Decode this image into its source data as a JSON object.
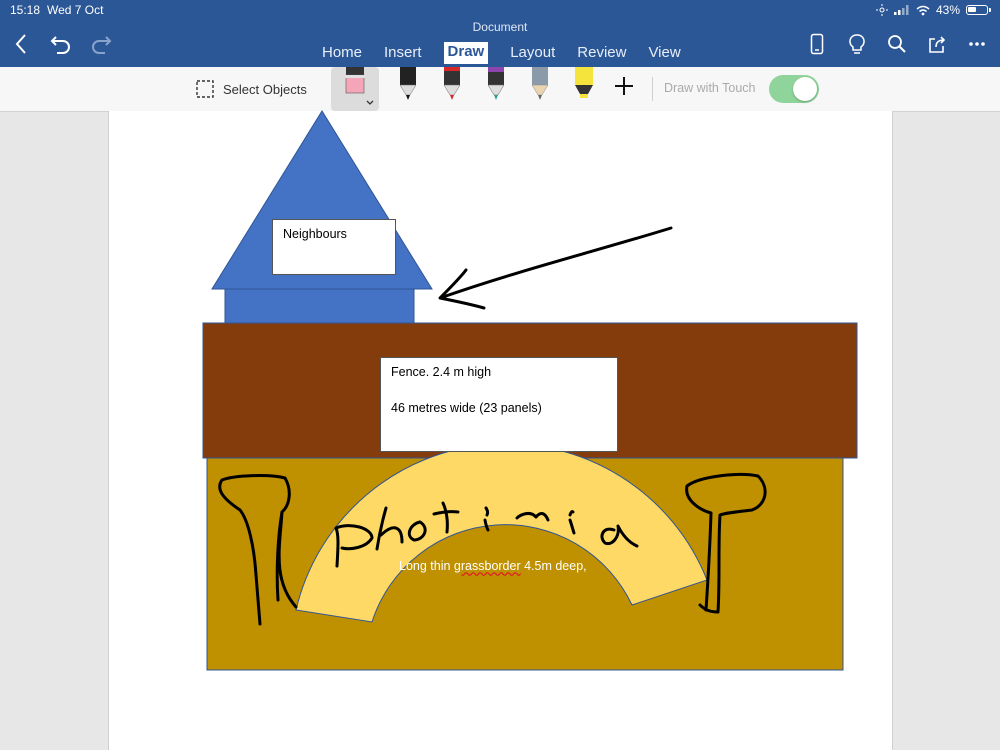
{
  "status_bar": {
    "time": "15:18",
    "date": "Wed 7 Oct",
    "battery": "43%"
  },
  "app": {
    "document_title": "Document"
  },
  "tabs": [
    {
      "label": "Home",
      "active": false
    },
    {
      "label": "Insert",
      "active": false
    },
    {
      "label": "Draw",
      "active": true
    },
    {
      "label": "Layout",
      "active": false
    },
    {
      "label": "Review",
      "active": false
    },
    {
      "label": "View",
      "active": false
    }
  ],
  "toolbar": {
    "select_objects_label": "Select Objects",
    "draw_with_touch_label": "Draw with Touch",
    "draw_with_touch_on": true,
    "pens": [
      {
        "name": "eraser",
        "color": "#f4a6b8"
      },
      {
        "name": "black-pen",
        "color": "#111111"
      },
      {
        "name": "red-pen",
        "color": "#d62828"
      },
      {
        "name": "galaxy-pen",
        "color": "#2aa198"
      },
      {
        "name": "pencil",
        "color": "#9aa3ad"
      },
      {
        "name": "highlighter",
        "color": "#f5e43c"
      }
    ]
  },
  "document": {
    "neighbours_label": "Neighbours",
    "fence_line1": "Fence. 2.4 m high",
    "fence_line2": "46 metres wide (23 panels)",
    "grass_prefix": "Long thin ",
    "grass_word": "grassborder",
    "grass_suffix": " 4.5m deep,",
    "handwriting": "Photinia",
    "colors": {
      "house": "#4472c4",
      "fence": "#843c0c",
      "garden": "#bf9000",
      "arch": "#ffd966",
      "accent": "#2b5797"
    }
  }
}
